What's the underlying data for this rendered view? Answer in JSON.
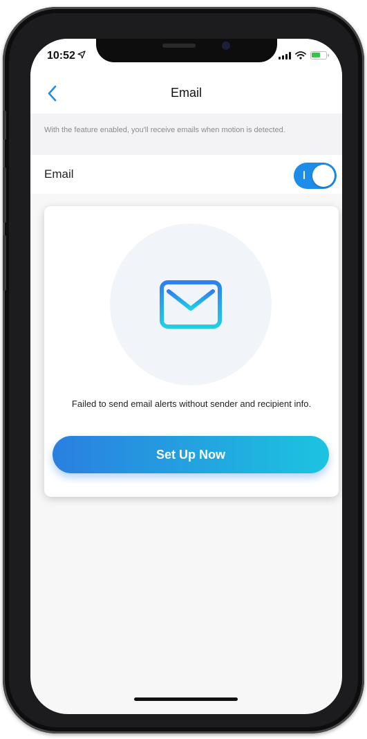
{
  "status_bar": {
    "time": "10:52",
    "location_icon": "location-arrow-icon",
    "signal_icon": "cellular-signal-icon",
    "wifi_icon": "wifi-icon",
    "battery_icon": "battery-charging-icon",
    "battery_color": "#3ac04c"
  },
  "nav": {
    "back_icon": "chevron-left-icon",
    "title": "Email"
  },
  "description": "With the feature enabled, you'll receive emails when motion is detected.",
  "email_toggle": {
    "label": "Email",
    "state": "on",
    "color": "#1d8de8"
  },
  "card": {
    "icon": "envelope-icon",
    "message": "Failed to send email alerts without sender and recipient info.",
    "button_label": "Set Up Now",
    "button_gradient": [
      "#2a7fe0",
      "#1cc4e0"
    ]
  },
  "colors": {
    "accent": "#1d8de8",
    "background": "#f7f7f8"
  }
}
